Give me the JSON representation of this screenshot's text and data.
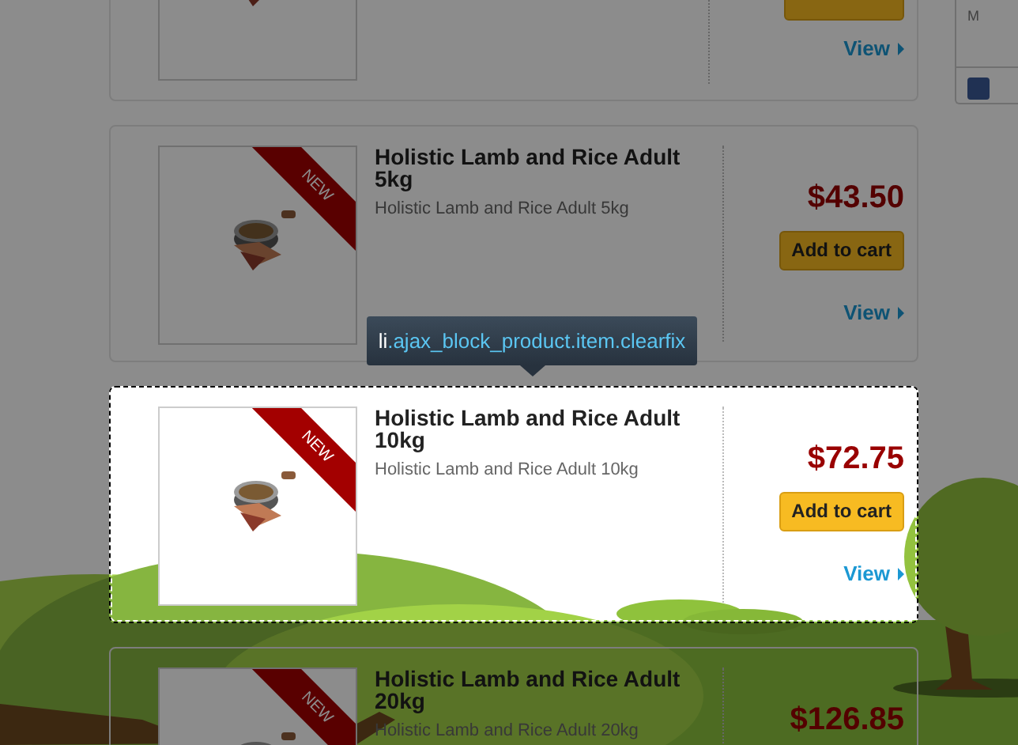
{
  "sidebar": {
    "text": "M"
  },
  "products": [
    {
      "kind": "partial",
      "highlighted": false,
      "view": "View"
    },
    {
      "kind": "full",
      "highlighted": false,
      "ribbon": "NEW",
      "title": "Holistic Lamb and Rice Adult 5kg",
      "description": "Holistic Lamb and Rice Adult 5kg",
      "price": "$43.50",
      "button": "Add to cart",
      "view": "View"
    },
    {
      "kind": "full",
      "highlighted": true,
      "ribbon": "NEW",
      "title": "Holistic Lamb and Rice Adult 10kg",
      "description": "Holistic Lamb and Rice Adult 10kg",
      "price": "$72.75",
      "button": "Add to cart",
      "view": "View"
    },
    {
      "kind": "full",
      "highlighted": false,
      "ribbon": "NEW",
      "title": "Holistic Lamb and Rice Adult 20kg",
      "description": "Holistic Lamb and Rice Adult 20kg",
      "price": "$126.85"
    }
  ],
  "tooltip": {
    "tag": "li",
    "classes": ".ajax_block_product.item.clearfix"
  }
}
